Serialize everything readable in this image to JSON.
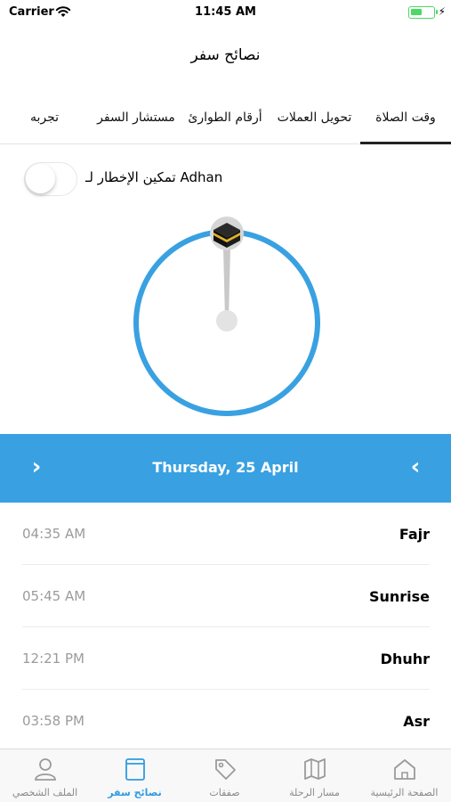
{
  "status_bar": {
    "carrier": "Carrier",
    "time": "11:45 AM",
    "battery_color": "#4cd964"
  },
  "nav": {
    "title": "نصائح سفر"
  },
  "tabs": [
    {
      "label": "وقت الصلاة",
      "active": true
    },
    {
      "label": "تحويل العملات",
      "active": false
    },
    {
      "label": "أرقام الطوارئ",
      "active": false
    },
    {
      "label": "مستشار السفر",
      "active": false
    },
    {
      "label": "تجربه",
      "active": false
    }
  ],
  "adhan": {
    "label": "تمكين الإخطار لـ Adhan",
    "enabled": false
  },
  "compass": {
    "ring_color": "#39a1e1",
    "icon": "kaaba-icon"
  },
  "date_bar": {
    "date": "Thursday, 25 April",
    "background": "#39a1e1",
    "prev_icon": "chevron-right-icon",
    "next_icon": "chevron-left-icon"
  },
  "prayers": [
    {
      "name": "Fajr",
      "time": "04:35 AM"
    },
    {
      "name": "Sunrise",
      "time": "05:45 AM"
    },
    {
      "name": "Dhuhr",
      "time": "12:21 PM"
    },
    {
      "name": "Asr",
      "time": "03:58 PM"
    }
  ],
  "bottom_nav": [
    {
      "label": "الملف الشخصي",
      "icon": "profile-icon",
      "active": false
    },
    {
      "label": "نصائح سفر",
      "icon": "book-icon",
      "active": true
    },
    {
      "label": "صفقات",
      "icon": "tag-icon",
      "active": false
    },
    {
      "label": "مسار الرحلة",
      "icon": "map-icon",
      "active": false
    },
    {
      "label": "الصفحة الرئيسية",
      "icon": "home-icon",
      "active": false
    }
  ],
  "accent_color": "#2f9be0"
}
